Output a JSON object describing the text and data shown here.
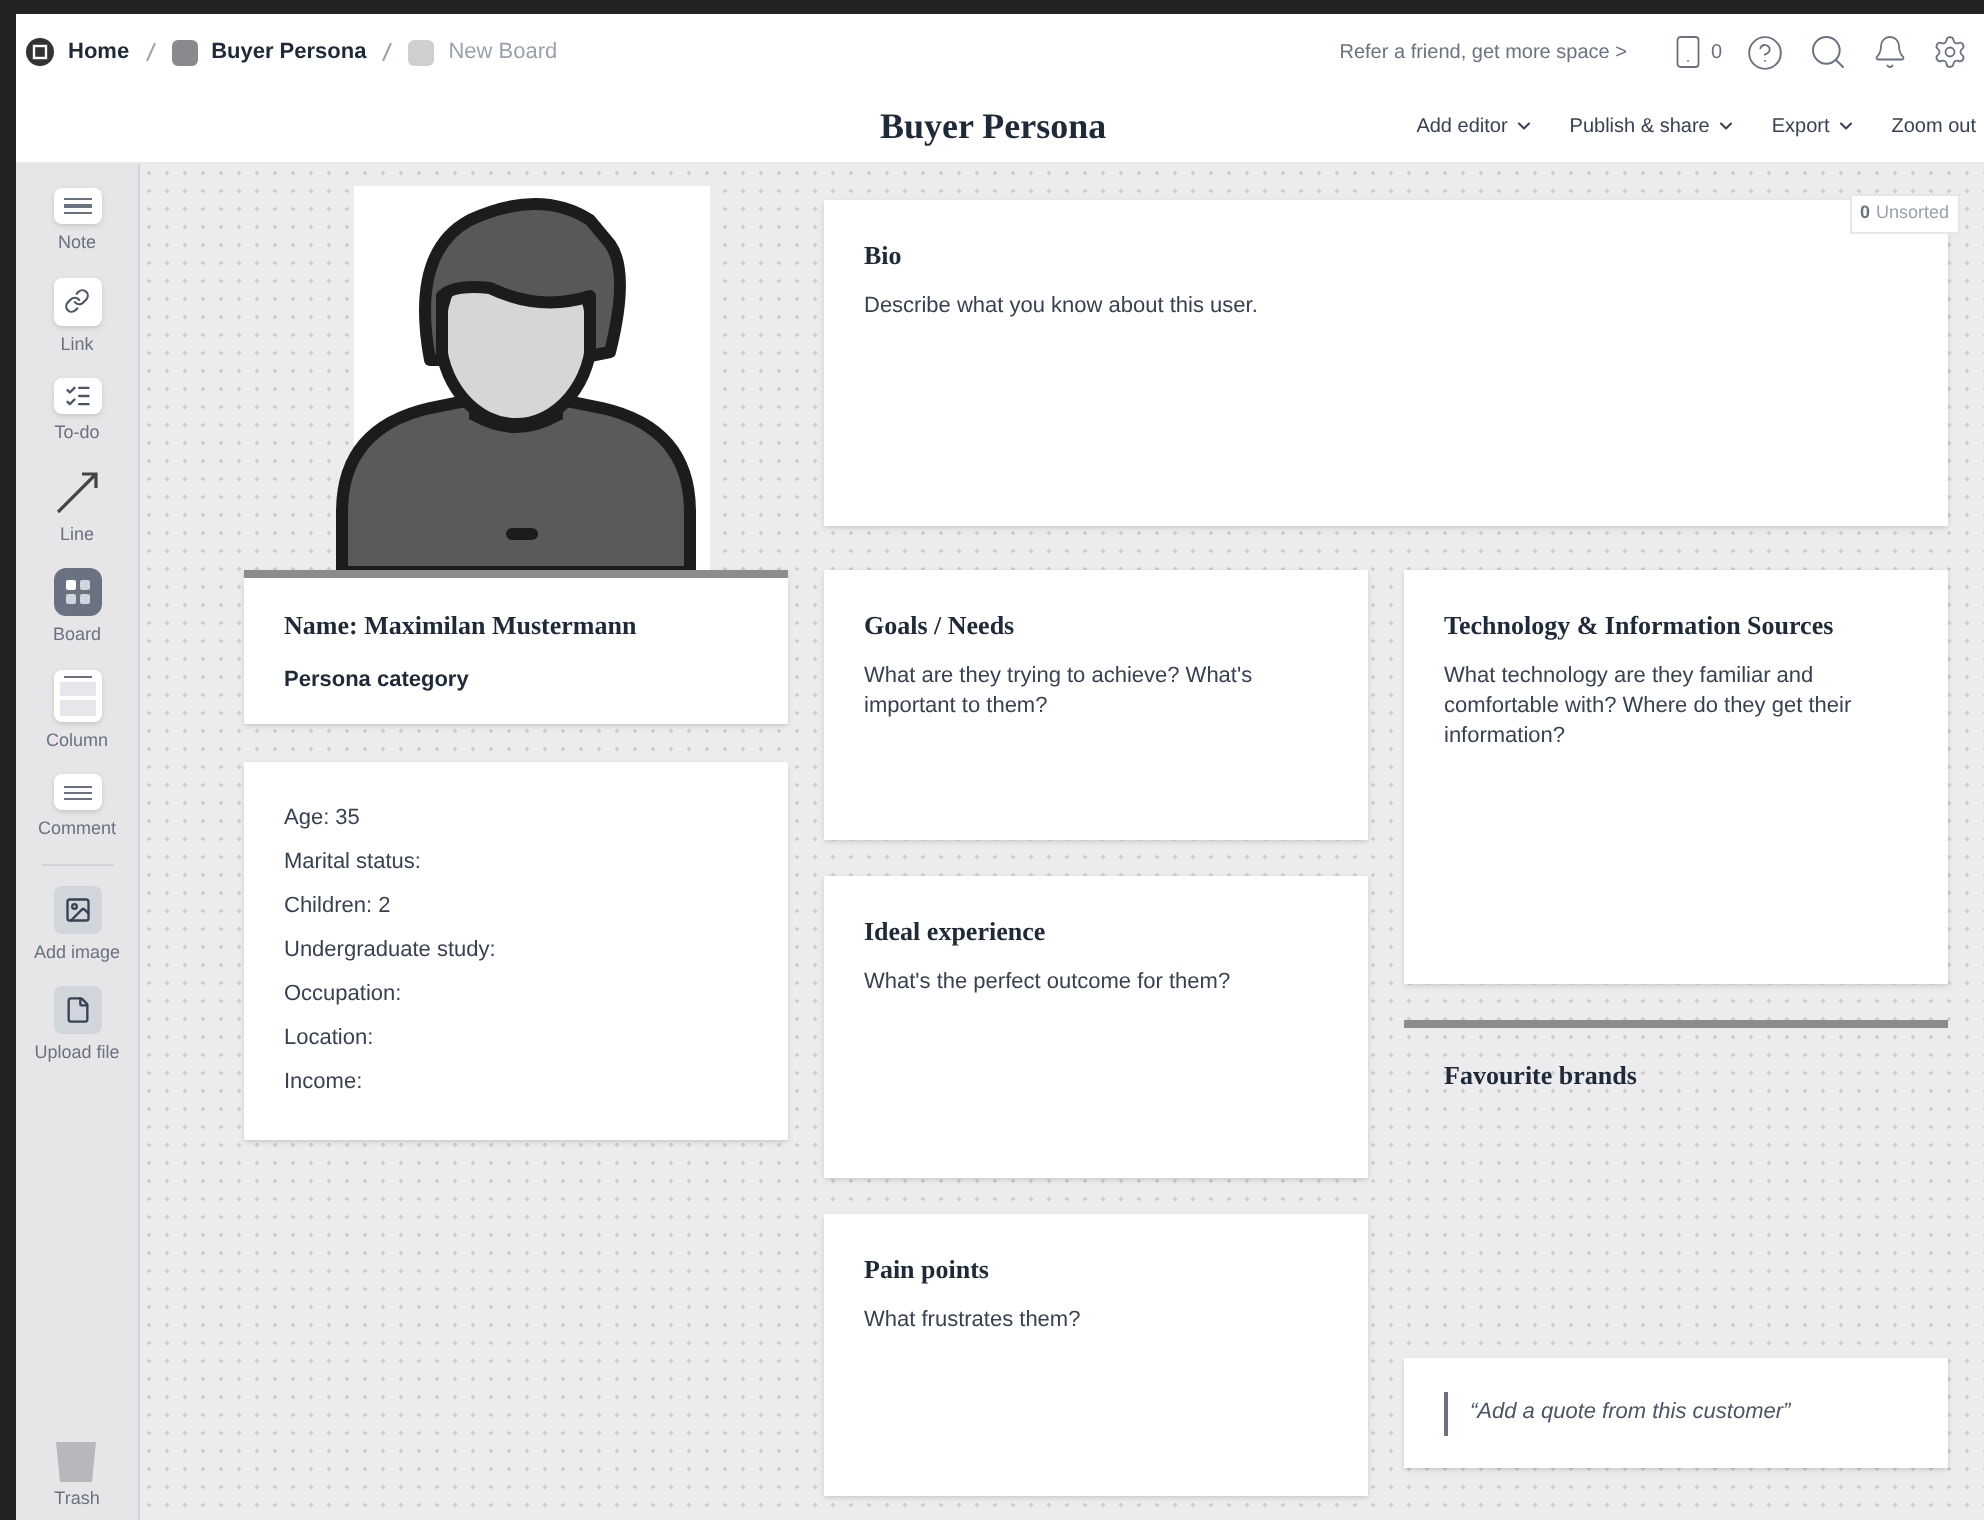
{
  "breadcrumbs": [
    {
      "label": "Home",
      "kind": "home",
      "current": false
    },
    {
      "label": "Buyer Persona",
      "kind": "board",
      "color": "#8a8a8e",
      "current": false
    },
    {
      "label": "New Board",
      "kind": "board",
      "color": "#cfcfd2",
      "current": true
    }
  ],
  "top_bar": {
    "refer": "Refer a friend, get more space >",
    "device_count": "0"
  },
  "title": "Buyer Persona",
  "toolbar": [
    {
      "label": "Add editor",
      "has_menu": true
    },
    {
      "label": "Publish & share",
      "has_menu": true
    },
    {
      "label": "Export",
      "has_menu": true
    },
    {
      "label": "Zoom out",
      "has_menu": false
    }
  ],
  "sidebar": {
    "tools": [
      {
        "label": "Note",
        "kind": "note"
      },
      {
        "label": "Link",
        "kind": "link"
      },
      {
        "label": "To-do",
        "kind": "todo"
      },
      {
        "label": "Line",
        "kind": "line"
      },
      {
        "label": "Board",
        "kind": "board"
      },
      {
        "label": "Column",
        "kind": "column"
      },
      {
        "label": "Comment",
        "kind": "comment"
      }
    ],
    "media": [
      {
        "label": "Add image",
        "kind": "image"
      },
      {
        "label": "Upload file",
        "kind": "file"
      }
    ],
    "trash": "Trash"
  },
  "unsorted": {
    "count": "0",
    "label": "Unsorted"
  },
  "persona": {
    "name": "Name: Maximilan Mustermann",
    "category": "Persona category"
  },
  "details": [
    "Age: 35",
    "Marital status:",
    "Children: 2",
    "Undergraduate study:",
    "Occupation:",
    "Location:",
    "Income:"
  ],
  "cards": [
    {
      "title": "Bio",
      "text": "Describe what you know about this user."
    },
    {
      "title": "Goals / Needs",
      "text": "What are they trying to achieve? What's important to them?"
    },
    {
      "title": "Ideal experience",
      "text": "What's the perfect outcome for them?"
    },
    {
      "title": "Pain points",
      "text": "What frustrates them?"
    },
    {
      "title": "Technology & Information Sources",
      "text": "What technology are they familiar and comfortable with? Where do they get their information?"
    }
  ],
  "column": {
    "title": "Favourite brands"
  },
  "quote": "“Add a quote from this customer”"
}
